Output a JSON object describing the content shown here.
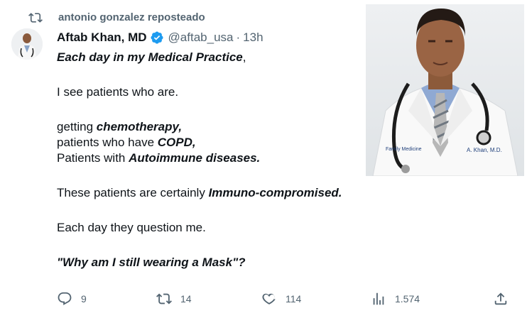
{
  "repost": {
    "icon": "repost-icon",
    "text": "antonio gonzalez reposteado"
  },
  "tweet": {
    "author": "Aftab Khan, MD",
    "verified": true,
    "handle": "@aftab_usa",
    "separator": "·",
    "time": "13h",
    "lines": {
      "l1": "Each day in my Medical Practice",
      "l1_comma": ",",
      "l2": "I see patients who are.",
      "l3_plain": "getting ",
      "l3_bold": "chemotherapy,",
      "l4_plain": "patients who have ",
      "l4_bold": "COPD,",
      "l5_plain": "Patients with ",
      "l5_bold": "Autoimmune diseases.",
      "l6_plain": "These patients are certainly ",
      "l6_bold": "Immuno-compromised.",
      "l7": "Each day they question me.",
      "l8": "\"Why am I still wearing a Mask\"?"
    },
    "photo_caption": "A. Khan, M.D.",
    "photo_badge": "Family Medicine"
  },
  "actions": {
    "reply": {
      "icon": "reply-icon",
      "count": "9"
    },
    "retweet": {
      "icon": "repost-icon",
      "count": "14"
    },
    "like": {
      "icon": "heart-icon",
      "count": "114"
    },
    "views": {
      "icon": "views-icon",
      "count": "1.574"
    },
    "share": {
      "icon": "share-icon"
    }
  },
  "colors": {
    "text": "#0f1419",
    "muted": "#536471",
    "verified": "#1d9bf0"
  }
}
